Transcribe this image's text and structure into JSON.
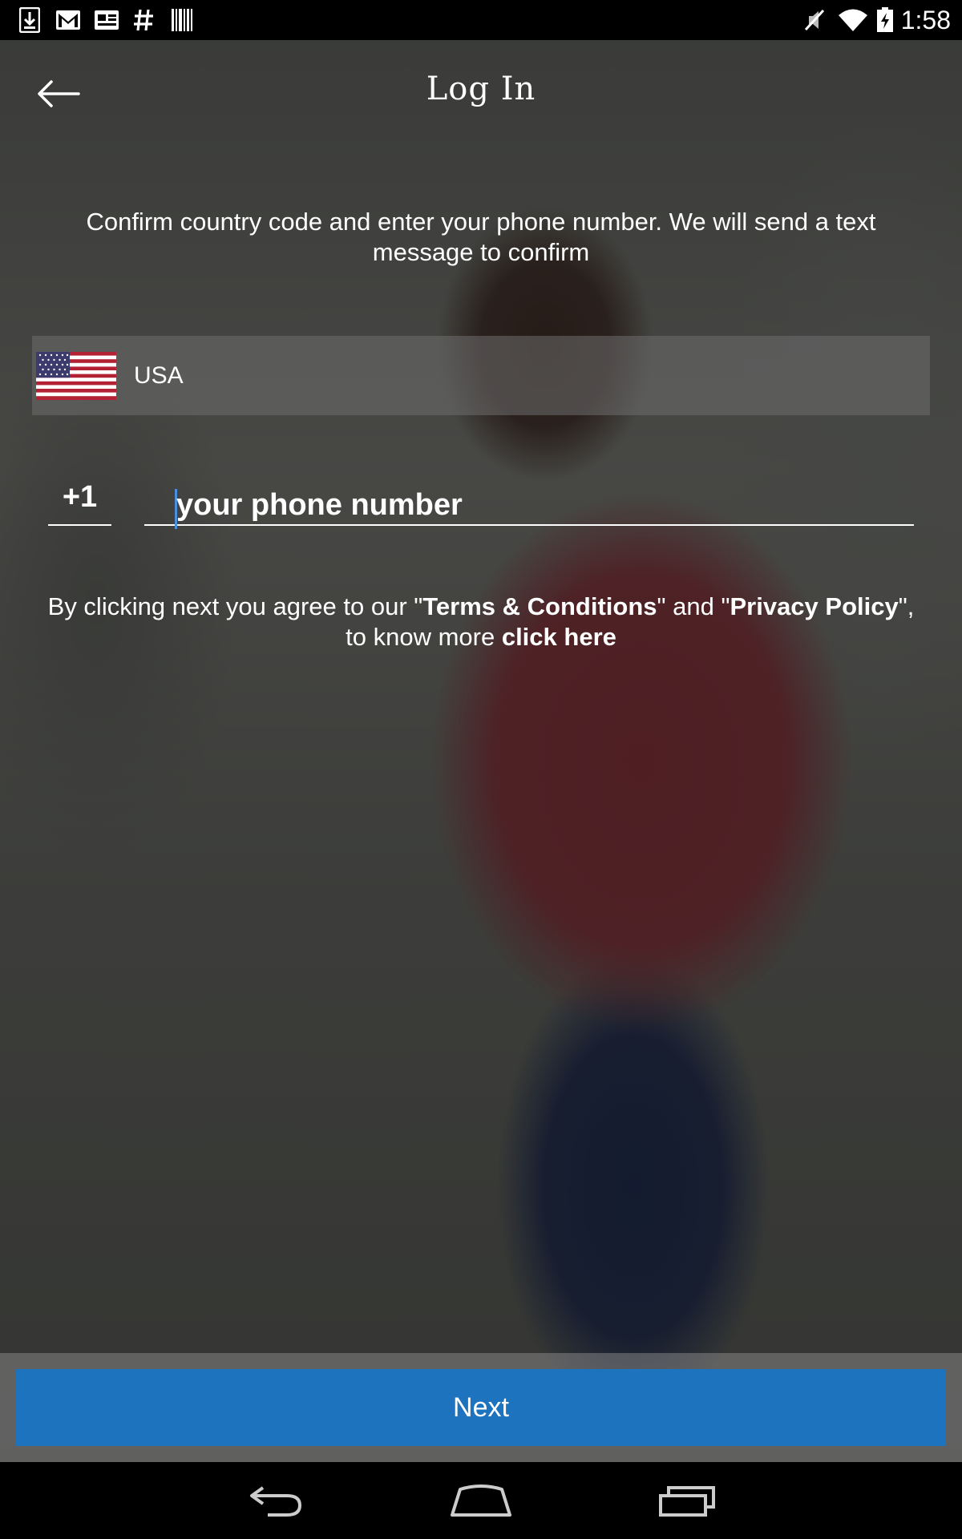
{
  "status_bar": {
    "time": "1:58",
    "left_icons": [
      "download-icon",
      "gmail-icon",
      "news-icon",
      "hashtag-icon",
      "barcode-icon"
    ],
    "right_icons": [
      "mute-icon",
      "wifi-icon",
      "battery-charging-icon"
    ]
  },
  "header": {
    "title": "Log In",
    "back_icon": "back-arrow-icon"
  },
  "instructions": "Confirm country code and enter your phone number. We will send a text message to confirm",
  "country": {
    "name": "USA",
    "flag_icon": "usa-flag-icon"
  },
  "phone": {
    "country_code": "+1",
    "placeholder": "your phone number"
  },
  "terms": {
    "prefix": "By clicking next you agree to our \"",
    "terms_link": "Terms & Conditions",
    "middle": "\" and \"",
    "privacy_link": "Privacy Policy",
    "suffix": "\",",
    "more_prefix": "to know more ",
    "click_here": "click here"
  },
  "next_button": {
    "label": "Next",
    "color": "#1e73be"
  },
  "nav_bar": {
    "icons": [
      "nav-back-icon",
      "nav-home-icon",
      "nav-recents-icon"
    ]
  }
}
